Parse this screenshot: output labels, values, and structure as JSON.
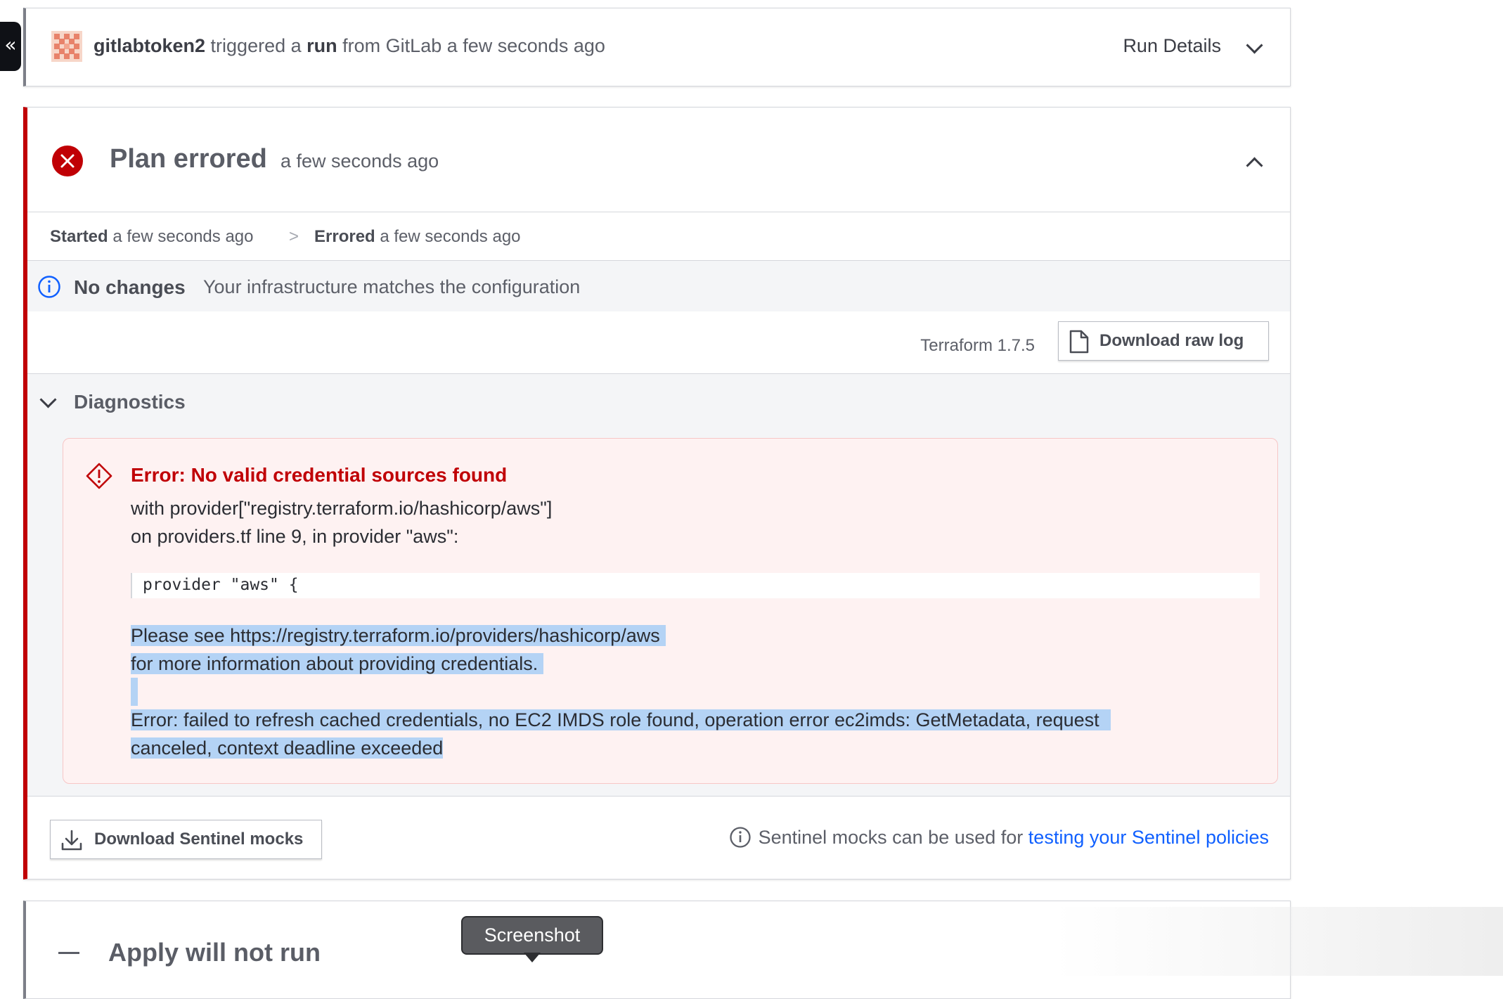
{
  "sidebar_toggle": {
    "glyph": "«"
  },
  "run": {
    "user": "gitlabtoken2",
    "text_1": "triggered a",
    "run_word": "run",
    "text_2": "from GitLab a few seconds ago",
    "details_label": "Run Details"
  },
  "plan": {
    "title": "Plan errored",
    "time": "a few seconds ago",
    "status_color": "#c00005",
    "timeline": {
      "started_label": "Started",
      "started_time": "a few seconds ago",
      "separator": ">",
      "errored_label": "Errored",
      "errored_time": "a few seconds ago"
    },
    "no_changes": {
      "label": "No changes",
      "message": "Your infrastructure matches the configuration"
    },
    "terraform_version": "Terraform 1.7.5",
    "download_raw_log": "Download raw log",
    "diagnostics": {
      "title": "Diagnostics",
      "error": {
        "title": "Error: No valid credential sources found",
        "line_1": "with provider[\"registry.terraform.io/hashicorp/aws\"]",
        "line_2": "on providers.tf line 9, in provider \"aws\":",
        "code": "provider \"aws\" {",
        "selected_1": "Please see https://registry.terraform.io/providers/hashicorp/aws",
        "selected_2": "for more information about providing credentials.",
        "selected_3": "Error: failed to refresh cached credentials, no EC2 IMDS role found, operation error ec2imds: GetMetadata, request",
        "selected_4": "canceled, context deadline exceeded"
      }
    },
    "sentinel": {
      "download_label": "Download Sentinel mocks",
      "message": "Sentinel mocks can be used for",
      "link": "testing your Sentinel policies"
    }
  },
  "apply": {
    "title": "Apply will not run"
  },
  "tooltip": {
    "text": "Screenshot"
  }
}
